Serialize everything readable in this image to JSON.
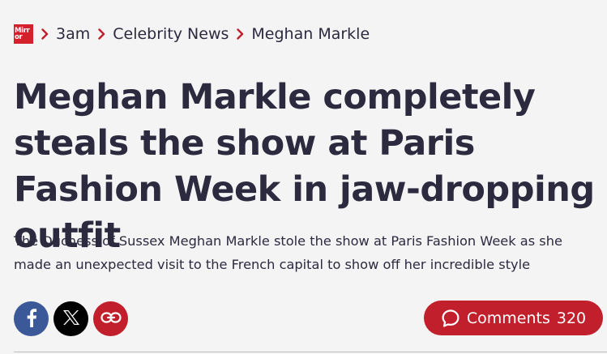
{
  "breadcrumb": {
    "logo_text_line1": "Mirr",
    "logo_text_line2": "or",
    "items": [
      "3am",
      "Celebrity News",
      "Meghan Markle"
    ]
  },
  "article": {
    "headline": "Meghan Markle completely steals the show at Paris Fashion Week in jaw-dropping outfit",
    "standfirst": "The Duchess of Sussex Meghan Markle stole the show at Paris Fashion Week as she made an unexpected visit to the French capital to show off her incredible style"
  },
  "share": {
    "facebook_icon": "facebook-icon",
    "x_icon": "x-icon",
    "link_icon": "link-icon"
  },
  "comments": {
    "label": "Comments",
    "count": "320"
  },
  "colors": {
    "brand_red": "#c01f2b",
    "facebook_blue": "#3b5998",
    "text_dark": "#2c2a3f",
    "background": "#f4f4f4"
  }
}
